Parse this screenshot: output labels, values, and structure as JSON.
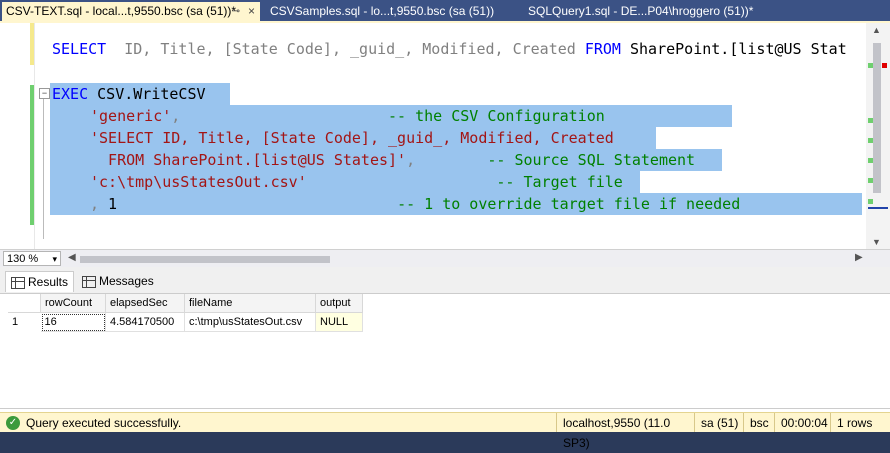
{
  "tabs": [
    {
      "label": "CSV-TEXT.sql - local...t,9550.bsc (sa (51))*",
      "pin": "⊸",
      "close": "×"
    },
    {
      "label": "CSVSamples.sql - lo...t,9550.bsc (sa (51))"
    },
    {
      "label": "SQLQuery1.sql - DE...P04\\hroggero (51))*"
    }
  ],
  "editor": {
    "line1": {
      "kw_select": "SELECT",
      "cols": "  ID, Title, [State Code], _guid_, Modified, Created ",
      "kw_from": "FROM",
      "rest": " SharePoint.[list@US Stat"
    },
    "line3": {
      "kw_exec": "EXEC",
      "proc": " CSV.WriteCSV"
    },
    "line4": {
      "str": "'generic'",
      "punct": ",",
      "pad": "                       ",
      "cmt": "-- the CSV Configuration"
    },
    "line5": {
      "str": "'SELECT ID, Title, [State Code], _guid_, Modified, Created"
    },
    "line6": {
      "str": "  FROM SharePoint.[list@US States]'",
      "punct": ",",
      "pad": "        ",
      "cmt": "-- Source SQL Statement"
    },
    "line7": {
      "str": "'c:\\tmp\\usStatesOut.csv'",
      "pad": "                     ",
      "cmt": "-- Target file"
    },
    "line8": {
      "punct": ",",
      "val": " 1",
      "pad": "                               ",
      "cmt": "-- 1 to override target file if needed"
    }
  },
  "zoom": {
    "value": "130 %"
  },
  "results_tabs": [
    {
      "label": "Results"
    },
    {
      "label": "Messages"
    }
  ],
  "grid": {
    "columns": [
      "rowCount",
      "elapsedSec",
      "fileName",
      "output"
    ],
    "rows": [
      {
        "num": "1",
        "cells": [
          "16",
          "4.584170500",
          "c:\\tmp\\usStatesOut.csv",
          "NULL"
        ]
      }
    ]
  },
  "status": {
    "message": "Query executed successfully.",
    "server": "localhost,9550 (11.0 SP3)",
    "user": "sa (51)",
    "database": "bsc",
    "elapsed": "00:00:04",
    "rows": "1 rows"
  },
  "colors": {
    "tab_active": "#fff6cf",
    "chrome": "#3b5285",
    "selection": "#99c4ee",
    "keyword": "#0000ff",
    "string": "#a31515",
    "comment": "#008000",
    "status_bar": "#fff6cf",
    "success": "#3c9a3c"
  }
}
